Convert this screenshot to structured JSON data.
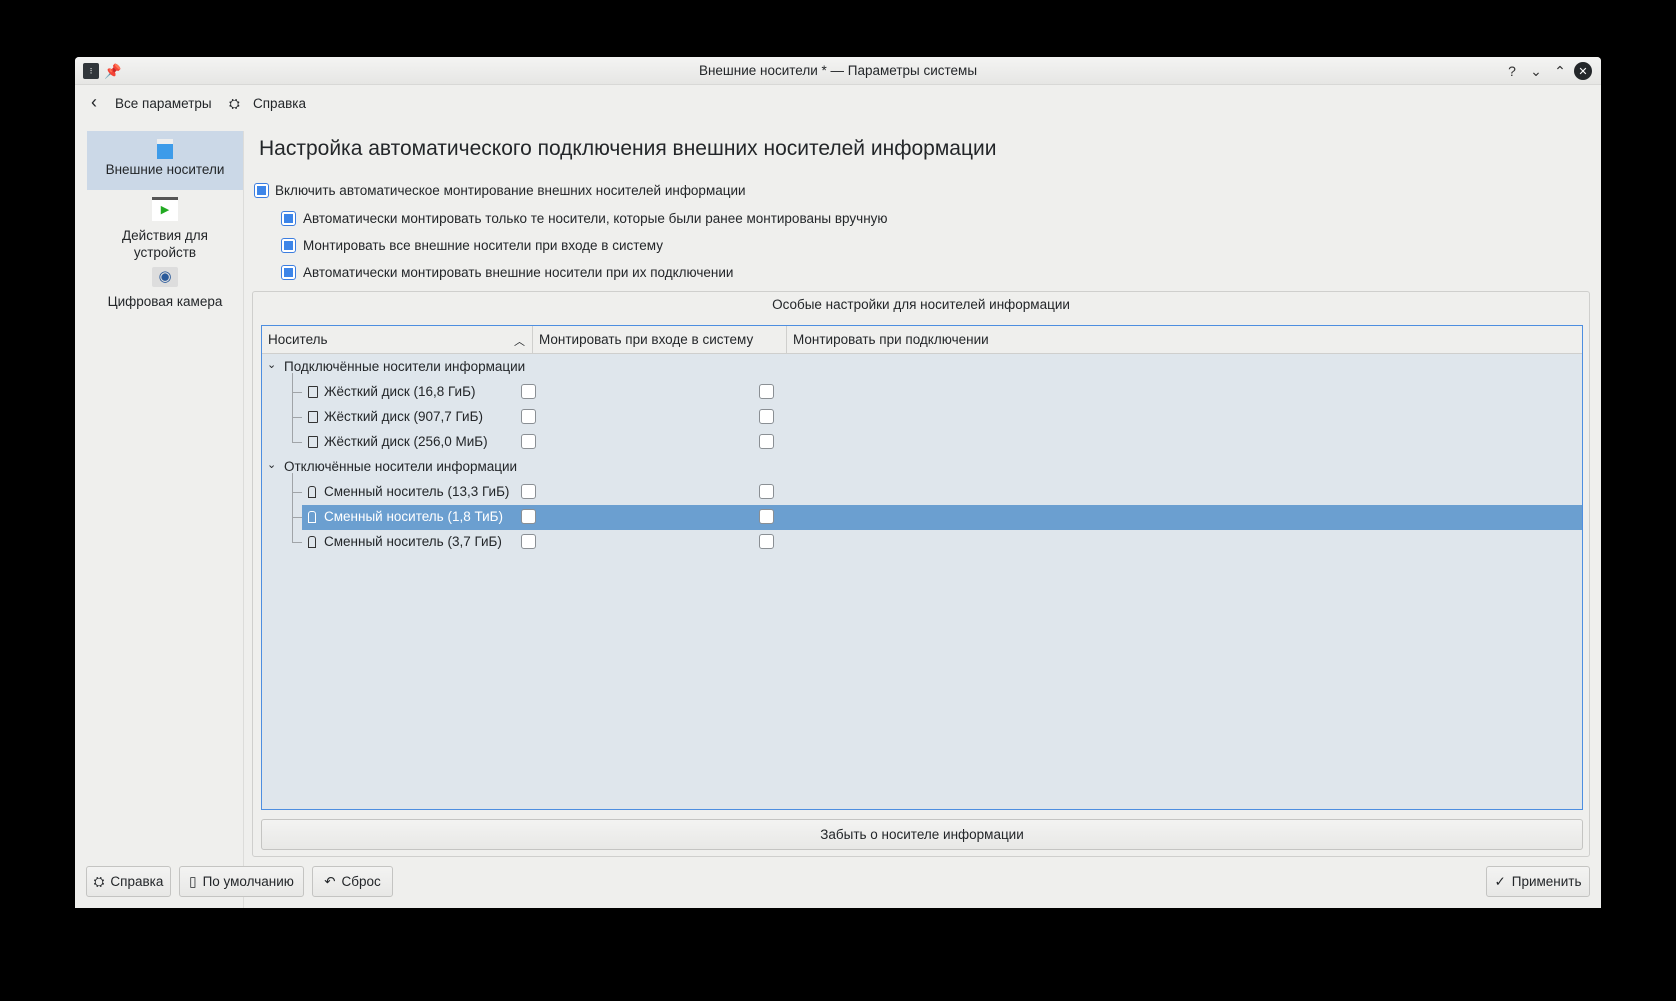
{
  "window": {
    "title": "Внешние носители * — Параметры системы"
  },
  "toolbar": {
    "back_label": "Все параметры",
    "help_label": "Справка"
  },
  "sidebar": {
    "items": [
      {
        "label": "Внешние носители",
        "selected": true
      },
      {
        "label": "Действия для устройств"
      },
      {
        "label": "Цифровая камера"
      }
    ]
  },
  "main": {
    "heading": "Настройка автоматического подключения внешних носителей информации",
    "options": [
      {
        "label": "Включить автоматическое монтирование внешних носителей информации",
        "checked": true
      },
      {
        "label": "Автоматически монтировать только те носители, которые были ранее монтированы вручную",
        "checked": true
      },
      {
        "label": "Монтировать все внешние носители при входе в систему",
        "checked": true
      },
      {
        "label": "Автоматически монтировать внешние носители при их подключении",
        "checked": true
      }
    ],
    "group_title": "Особые настройки для носителей информации",
    "columns": [
      "Носитель",
      "Монтировать при входе в систему",
      "Монтировать при подключении"
    ],
    "groups": [
      {
        "label": "Подключённые носители информации",
        "items": [
          {
            "label": "Жёсткий диск (16,8 ГиБ)",
            "icon": "hard-disk"
          },
          {
            "label": "Жёсткий диск (907,7 ГиБ)",
            "icon": "hard-disk"
          },
          {
            "label": "Жёсткий диск (256,0 МиБ)",
            "icon": "hard-disk"
          }
        ]
      },
      {
        "label": "Отключённые носители информации",
        "items": [
          {
            "label": "Сменный носитель (13,3 ГиБ)",
            "icon": "usb-drive"
          },
          {
            "label": "Сменный носитель (1,8 ТиБ)",
            "icon": "usb-drive",
            "selected": true
          },
          {
            "label": "Сменный носитель (3,7 ГиБ)",
            "icon": "usb-drive"
          }
        ]
      }
    ],
    "forget_label": "Забыть о носителе информации"
  },
  "footer": {
    "help": "Справка",
    "defaults": "По умолчанию",
    "reset": "Сброс",
    "apply": "Применить"
  },
  "colors": {
    "accent": "#3d85e8",
    "selection": "#6b9fd0"
  }
}
